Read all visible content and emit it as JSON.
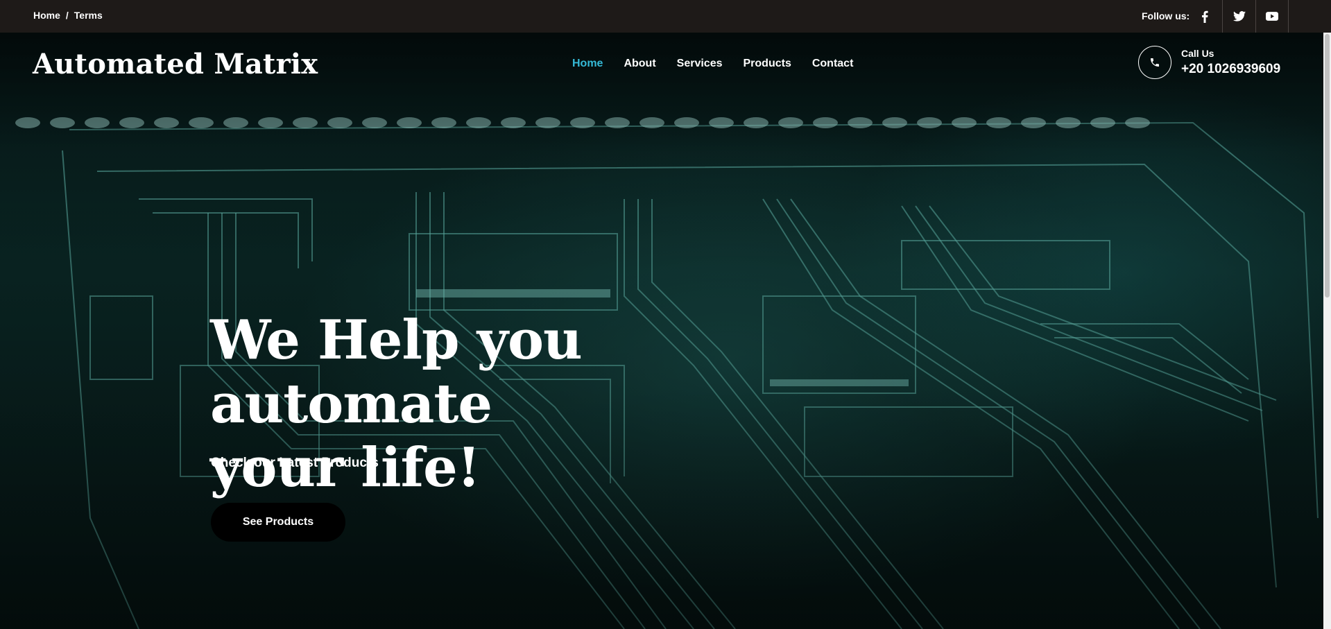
{
  "topbar": {
    "breadcrumb": [
      "Home",
      "Terms"
    ],
    "breadcrumb_separator": "/",
    "follow_label": "Follow us:",
    "social_icons": [
      "facebook-icon",
      "twitter-icon",
      "youtube-icon"
    ]
  },
  "header": {
    "brand": "Automated Matrix",
    "nav": [
      {
        "label": "Home",
        "active": true
      },
      {
        "label": "About",
        "active": false
      },
      {
        "label": "Services",
        "active": false
      },
      {
        "label": "Products",
        "active": false
      },
      {
        "label": "Contact",
        "active": false
      }
    ],
    "call_label": "Call Us",
    "call_number": "+20 1026939609",
    "call_icon": "phone-icon"
  },
  "hero": {
    "headline_line1": "We Help you automate",
    "headline_line2": "your life!",
    "subheadline": "Check our Latest Products",
    "cta_label": "See Products"
  },
  "colors": {
    "topbar_bg": "#1e1a18",
    "nav_active": "#35b9d6",
    "cta_bg": "#000000"
  }
}
